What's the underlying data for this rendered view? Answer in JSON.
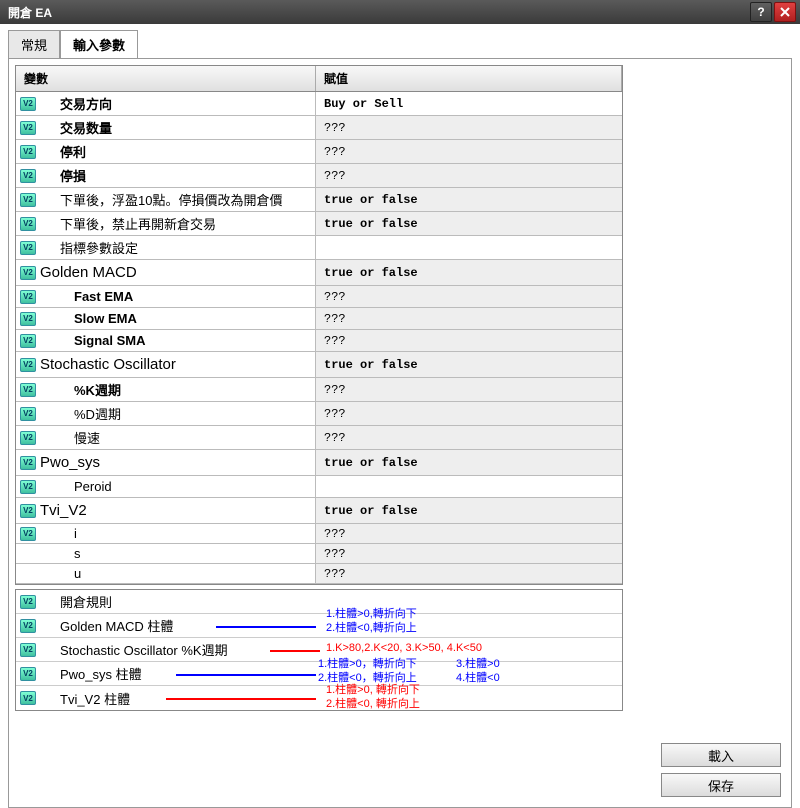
{
  "titlebar": {
    "title": "開倉 EA"
  },
  "tabs": [
    {
      "label": "常規",
      "active": false
    },
    {
      "label": "輸入參數",
      "active": true
    }
  ],
  "grid_headers": {
    "var": "變數",
    "val": "賦值"
  },
  "rows": [
    {
      "var": "交易方向",
      "val": "Buy or Sell",
      "bold": true,
      "indent": 1,
      "valStyle": "white"
    },
    {
      "var": "交易数量",
      "val": "???",
      "bold": true,
      "indent": 1
    },
    {
      "var": "停利",
      "val": "???",
      "bold": true,
      "indent": 1
    },
    {
      "var": "停損",
      "val": "???",
      "bold": true,
      "indent": 1
    },
    {
      "var": "下單後，浮盈10點。停損價改為開倉價",
      "val": "true or false",
      "bold": false,
      "indent": 1
    },
    {
      "var": "下單後，禁止再開新倉交易",
      "val": "true or false",
      "bold": false,
      "indent": 1
    },
    {
      "var": "指標參數設定",
      "val": "",
      "bold": false,
      "indent": 1,
      "valStyle": "white"
    },
    {
      "var": "Golden MACD",
      "val": "true or false",
      "bold": false,
      "indent": 0,
      "big": true
    },
    {
      "var": "Fast EMA",
      "val": "???",
      "bold": true,
      "indent": 2
    },
    {
      "var": "Slow EMA",
      "val": "???",
      "bold": true,
      "indent": 2
    },
    {
      "var": "Signal SMA",
      "val": "???",
      "bold": true,
      "indent": 2
    },
    {
      "var": "Stochastic Oscillator",
      "val": "true or false",
      "bold": false,
      "indent": 0,
      "big": true
    },
    {
      "var": "%K週期",
      "val": "???",
      "bold": true,
      "indent": 2
    },
    {
      "var": "%D週期",
      "val": "???",
      "bold": false,
      "indent": 2
    },
    {
      "var": "慢速",
      "val": "???",
      "bold": false,
      "indent": 2
    },
    {
      "var": "Pwo_sys",
      "val": "true or false",
      "bold": false,
      "indent": 0,
      "big": true
    },
    {
      "var": "Peroid",
      "val": "",
      "bold": false,
      "indent": 2,
      "valStyle": "white"
    },
    {
      "var": "Tvi_V2",
      "val": "true or false",
      "bold": false,
      "indent": 0,
      "big": true
    },
    {
      "var": "i",
      "val": "???",
      "bold": false,
      "indent": 2,
      "short": true
    },
    {
      "var": "s",
      "val": "???",
      "bold": false,
      "indent": 2,
      "short": true,
      "noicon": true
    },
    {
      "var": "u",
      "val": "???",
      "bold": false,
      "indent": 2,
      "short": true,
      "noicon": true
    }
  ],
  "rules": {
    "header": "開倉規則",
    "items": [
      {
        "label": "Golden MACD 柱體",
        "line": "blue"
      },
      {
        "label": "Stochastic Oscillator %K週期",
        "line": "red"
      },
      {
        "label": "Pwo_sys 柱體",
        "line": "blue"
      },
      {
        "label": "Tvi_V2 柱體",
        "line": "red"
      }
    ]
  },
  "annotations": {
    "macd1": "1.柱體>0,轉折向下",
    "macd2": "2.柱體<0,轉折向上",
    "stoch": "1.K>80,2.K<20, 3.K>50, 4.K<50",
    "pwo1": "1.柱體>0，轉折向下",
    "pwo2": "2.柱體<0，轉折向上",
    "pwo3": "3.柱體>0",
    "pwo4": "4.柱體<0",
    "tvi1": "1.柱體>0, 轉折向下",
    "tvi2": "2.柱體<0, 轉折向上"
  },
  "buttons": {
    "load": "載入",
    "save": "保存"
  },
  "icon_label": "V2"
}
